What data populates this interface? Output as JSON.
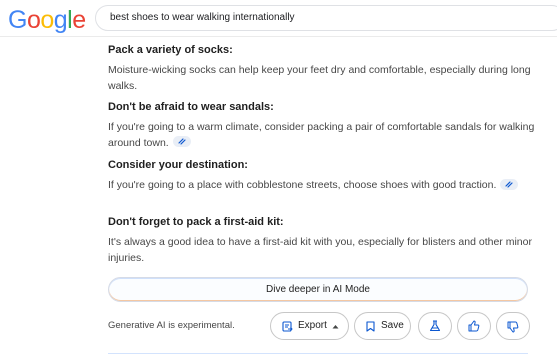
{
  "header": {
    "logo_letters": [
      {
        "ch": "G",
        "color": "#4285F4"
      },
      {
        "ch": "o",
        "color": "#EA4335"
      },
      {
        "ch": "o",
        "color": "#FBBC05"
      },
      {
        "ch": "g",
        "color": "#4285F4"
      },
      {
        "ch": "l",
        "color": "#34A853"
      },
      {
        "ch": "e",
        "color": "#EA4335"
      }
    ],
    "search_query": "best shoes to wear walking internationally"
  },
  "tips": [
    {
      "title": "Pack a variety of socks:",
      "body": "Moisture-wicking socks can help keep your feet dry and comfortable, especially during long walks.",
      "link_chip": false
    },
    {
      "title": "Don't be afraid to wear sandals:",
      "body": "If you're going to a warm climate, consider packing a pair of comfortable sandals for walking around town.",
      "link_chip": true
    },
    {
      "title": "Consider your destination:",
      "body": "If you're going to a place with cobblestone streets, choose shoes with good traction.",
      "link_chip": true
    },
    {
      "title": "Don't forget to pack a first-aid kit:",
      "body": "It's always a good idea to have a first-aid kit with you, especially for blisters and other minor injuries.",
      "link_chip": false
    }
  ],
  "dive_deeper_label": "Dive deeper in AI Mode",
  "footer": {
    "note": "Generative AI is experimental.",
    "export_label": "Export",
    "save_label": "Save"
  }
}
